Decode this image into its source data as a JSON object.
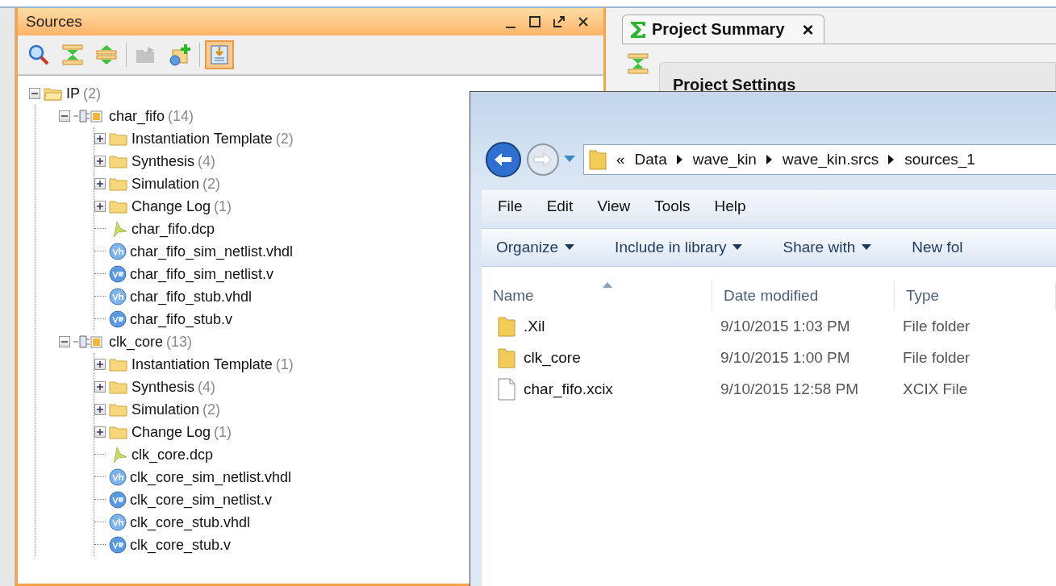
{
  "sources_panel": {
    "title": "Sources",
    "window_controls": [
      {
        "kind": "minimize"
      },
      {
        "kind": "maximize"
      },
      {
        "kind": "float"
      },
      {
        "kind": "close"
      }
    ],
    "toolbar": [
      {
        "kind": "search",
        "disabled": false,
        "selected": false
      },
      {
        "kind": "collapse",
        "disabled": false,
        "selected": false
      },
      {
        "kind": "expand",
        "disabled": false,
        "selected": false
      },
      {
        "kind": "separator"
      },
      {
        "kind": "open",
        "disabled": true,
        "selected": false
      },
      {
        "kind": "add",
        "disabled": false,
        "selected": false
      },
      {
        "kind": "separator"
      },
      {
        "kind": "pin",
        "disabled": false,
        "selected": true
      }
    ],
    "tree": [
      {
        "kind": "folder",
        "label": "IP",
        "count": "(2)",
        "expanded": true,
        "children": [
          {
            "kind": "ip",
            "label": "char_fifo",
            "count": "(14)",
            "expanded": true,
            "children": [
              {
                "kind": "folder",
                "label": "Instantiation Template",
                "count": "(2)",
                "expanded": false
              },
              {
                "kind": "folder",
                "label": "Synthesis",
                "count": "(4)",
                "expanded": false
              },
              {
                "kind": "folder",
                "label": "Simulation",
                "count": "(2)",
                "expanded": false
              },
              {
                "kind": "folder",
                "label": "Change Log",
                "count": "(1)",
                "expanded": false
              },
              {
                "kind": "dcp",
                "label": "char_fifo.dcp"
              },
              {
                "kind": "vhdl",
                "label": "char_fifo_sim_netlist.vhdl"
              },
              {
                "kind": "verilog",
                "label": "char_fifo_sim_netlist.v"
              },
              {
                "kind": "vhdl",
                "label": "char_fifo_stub.vhdl"
              },
              {
                "kind": "verilog",
                "label": "char_fifo_stub.v"
              }
            ]
          },
          {
            "kind": "ip",
            "label": "clk_core",
            "count": "(13)",
            "expanded": true,
            "children": [
              {
                "kind": "folder",
                "label": "Instantiation Template",
                "count": "(1)",
                "expanded": false
              },
              {
                "kind": "folder",
                "label": "Synthesis",
                "count": "(4)",
                "expanded": false
              },
              {
                "kind": "folder",
                "label": "Simulation",
                "count": "(2)",
                "expanded": false
              },
              {
                "kind": "folder",
                "label": "Change Log",
                "count": "(1)",
                "expanded": false
              },
              {
                "kind": "dcp",
                "label": "clk_core.dcp"
              },
              {
                "kind": "vhdl",
                "label": "clk_core_sim_netlist.vhdl"
              },
              {
                "kind": "verilog",
                "label": "clk_core_sim_netlist.v"
              },
              {
                "kind": "vhdl",
                "label": "clk_core_stub.vhdl"
              },
              {
                "kind": "verilog",
                "label": "clk_core_stub.v"
              }
            ]
          }
        ]
      }
    ]
  },
  "editor": {
    "tabs": [
      {
        "label": "Project Summary",
        "selected": true,
        "close": "×"
      }
    ],
    "section_title": "Project Settings"
  },
  "explorer": {
    "breadcrumb": {
      "overflow": "«",
      "items": [
        "Data",
        "wave_kin",
        "wave_kin.srcs",
        "sources_1"
      ]
    },
    "menu": [
      "File",
      "Edit",
      "View",
      "Tools",
      "Help"
    ],
    "commands": [
      {
        "label": "Organize",
        "dropdown": true
      },
      {
        "label": "Include in library",
        "dropdown": true
      },
      {
        "label": "Share with",
        "dropdown": true
      },
      {
        "label": "New fol",
        "dropdown": false
      }
    ],
    "columns": [
      {
        "label": "Name",
        "sorted": true
      },
      {
        "label": "Date modified",
        "sorted": false
      },
      {
        "label": "Type",
        "sorted": false
      }
    ],
    "rows": [
      {
        "kind": "folder",
        "name": ".Xil",
        "date": "9/10/2015 1:03 PM",
        "type": "File folder"
      },
      {
        "kind": "folder",
        "name": "clk_core",
        "date": "9/10/2015 1:00 PM",
        "type": "File folder"
      },
      {
        "kind": "file",
        "name": "char_fifo.xcix",
        "date": "9/10/2015 12:58 PM",
        "type": "XCIX File"
      }
    ]
  }
}
